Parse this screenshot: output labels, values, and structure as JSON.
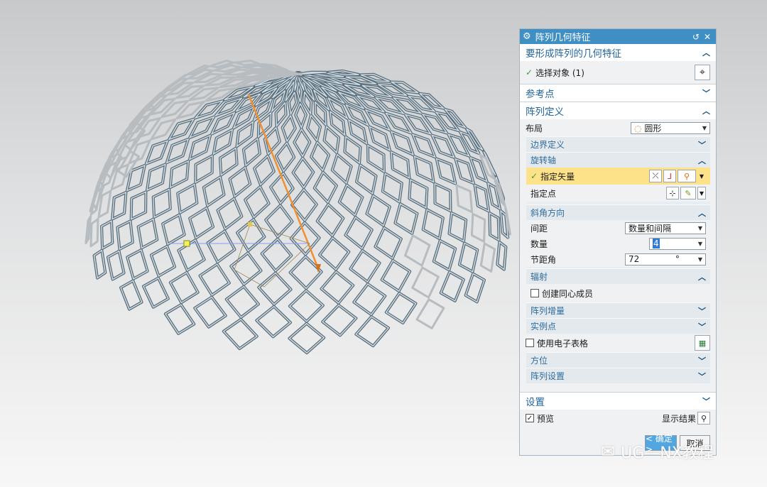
{
  "dialog": {
    "title": "阵列几何特征",
    "sections": {
      "geometry": {
        "label": "要形成阵列的几何特征",
        "select_object": "选择对象 (1)"
      },
      "reference": {
        "label": "参考点"
      },
      "definition": {
        "label": "阵列定义",
        "layout_label": "布局",
        "layout_value": "圆形",
        "boundary": "边界定义",
        "rotation_axis": "旋转轴",
        "specify_vector": "指定矢量",
        "specify_point": "指定点",
        "angle_direction": "斜角方向",
        "spacing_label": "间距",
        "spacing_value": "数量和间隔",
        "count_label": "数量",
        "count_value": "4",
        "pitch_label": "节距角",
        "pitch_value": "72",
        "pitch_unit": "°",
        "radial": "辐射",
        "concentric": "创建同心成员",
        "increment": "阵列增量",
        "instance": "实例点",
        "spreadsheet": "使用电子表格",
        "orientation": "方位",
        "settings": "阵列设置"
      },
      "settings": {
        "label": "设置"
      }
    },
    "preview_label": "预览",
    "show_result": "显示结果",
    "ok": "< 确定 >",
    "cancel": "取消"
  },
  "watermark": "UG—NX教程",
  "colors": {
    "accent": "#3f8fc4",
    "highlight": "#fde28a",
    "section_text": "#23659a"
  }
}
